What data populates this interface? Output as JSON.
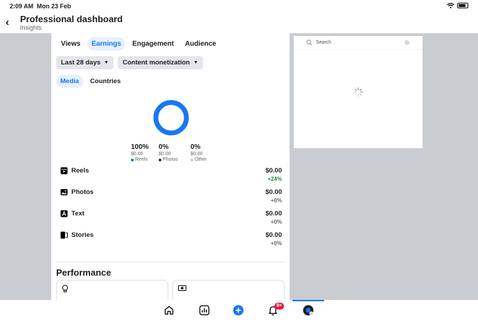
{
  "status": {
    "time": "2:09 AM",
    "date": "Mon 23 Feb"
  },
  "header": {
    "title": "Professional dashboard",
    "subtitle": "Insights"
  },
  "tabs": [
    "Views",
    "Earnings",
    "Engagement",
    "Audience"
  ],
  "active_tab": "Earnings",
  "filters": {
    "range": "Last 28 days",
    "type": "Content monetization"
  },
  "subtabs": [
    "Media",
    "Countries"
  ],
  "active_subtab": "Media",
  "breakdown": [
    {
      "percent": "100%",
      "amount": "$0.00",
      "label": "Reels",
      "color": "#1877f2",
      "share": 1.0
    },
    {
      "percent": "0%",
      "amount": "$0.00",
      "label": "Photos",
      "color": "#0b3d7a",
      "share": 0
    },
    {
      "percent": "0%",
      "amount": "$0.00",
      "label": "Other",
      "color": "#9fd3f7",
      "share": 0
    }
  ],
  "rows": [
    {
      "label": "Reels",
      "value": "$0.00",
      "change": "+24%",
      "icon": "reels-icon",
      "positive": true
    },
    {
      "label": "Photos",
      "value": "$0.00",
      "change": "+0%",
      "icon": "photos-icon",
      "positive": false
    },
    {
      "label": "Text",
      "value": "$0.00",
      "change": "+0%",
      "icon": "text-icon",
      "positive": false
    },
    {
      "label": "Stories",
      "value": "$0.00",
      "change": "+0%",
      "icon": "stories-icon",
      "positive": false
    }
  ],
  "performance": {
    "title": "Performance"
  },
  "search": {
    "placeholder": "Search"
  },
  "bottom_nav": {
    "notification_badge": "9+"
  },
  "colors": {
    "accent": "#1877f2",
    "positive": "#1f8a3c",
    "badge": "#e41e3f"
  }
}
